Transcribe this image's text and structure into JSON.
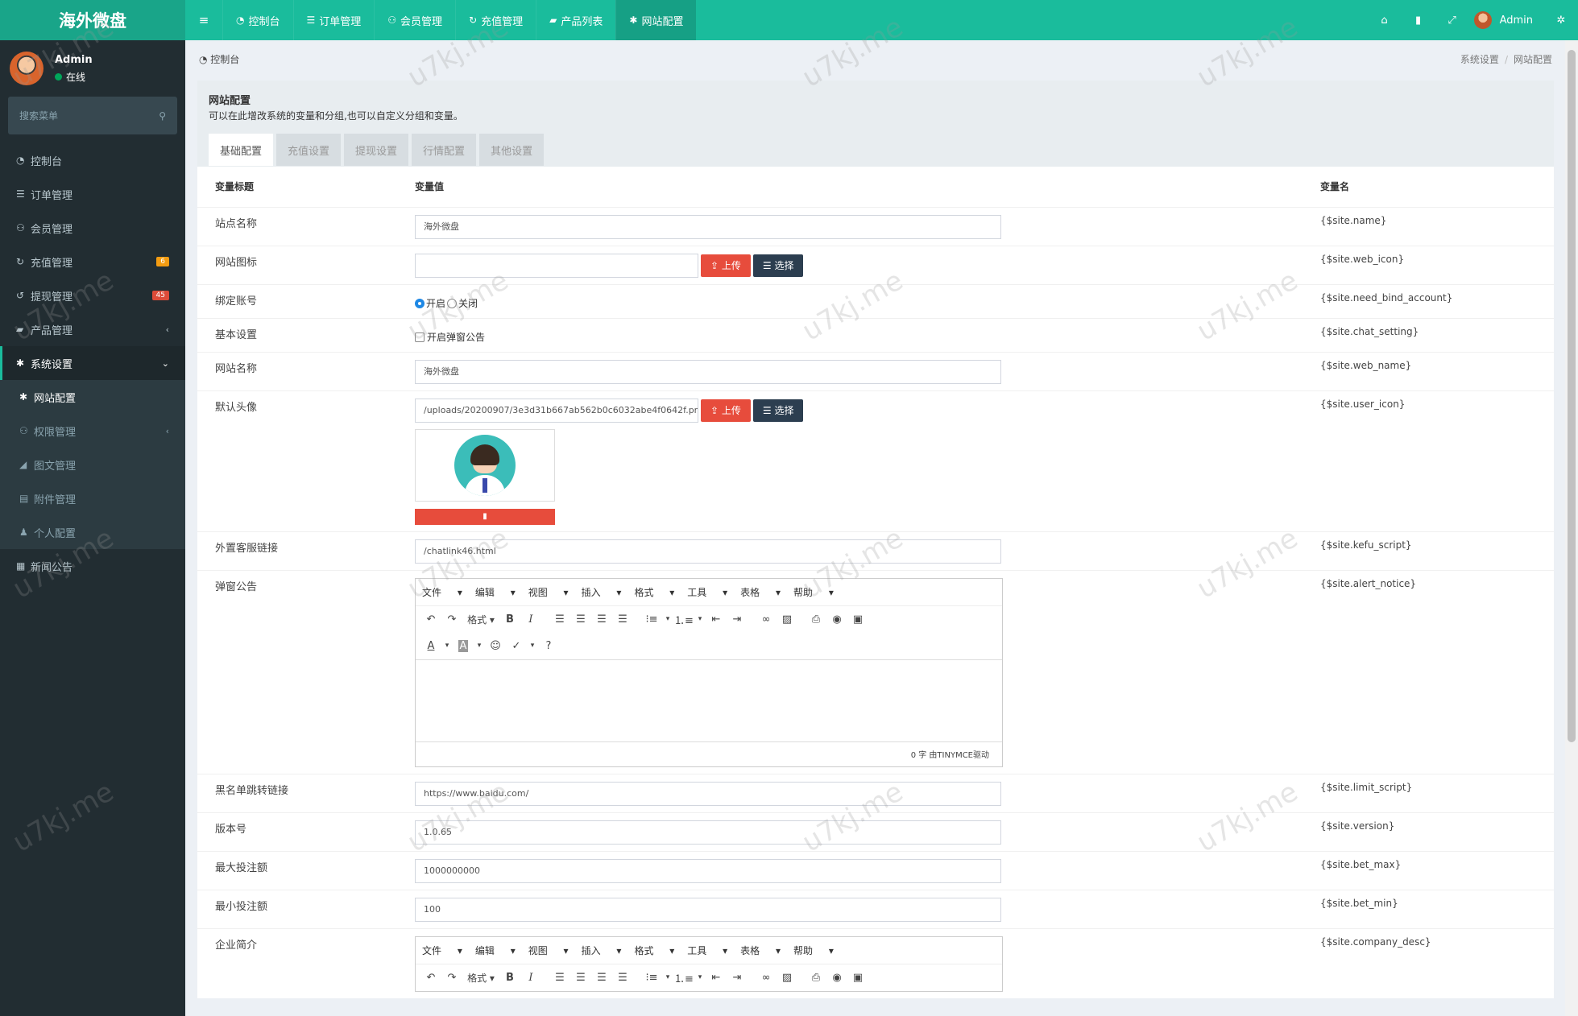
{
  "logo": "海外微盘",
  "topnav": [
    {
      "icon": "dashboard-icon",
      "glyph": "◔",
      "label": "控制台"
    },
    {
      "icon": "list-icon",
      "glyph": "☰",
      "label": "订单管理"
    },
    {
      "icon": "users-icon",
      "glyph": "⚇",
      "label": "会员管理"
    },
    {
      "icon": "recharge-icon",
      "glyph": "↻",
      "label": "充值管理"
    },
    {
      "icon": "product-icon",
      "glyph": "▰",
      "label": "产品列表"
    },
    {
      "icon": "gear-icon",
      "glyph": "✱",
      "label": "网站配置"
    }
  ],
  "topright": {
    "user": "Admin"
  },
  "sidebar": {
    "user_name": "Admin",
    "status": "在线",
    "search_placeholder": "搜索菜单",
    "items": [
      {
        "label": "控制台",
        "glyph": "◔"
      },
      {
        "label": "订单管理",
        "glyph": "☰"
      },
      {
        "label": "会员管理",
        "glyph": "⚇"
      },
      {
        "label": "充值管理",
        "glyph": "↻",
        "badge": "6",
        "badge_color": "#f39c12"
      },
      {
        "label": "提现管理",
        "glyph": "↺",
        "badge": "45",
        "badge_color": "#dd4b39"
      },
      {
        "label": "产品管理",
        "glyph": "▰"
      },
      {
        "label": "系统设置",
        "glyph": "✱"
      }
    ],
    "subitems": [
      {
        "label": "网站配置",
        "glyph": "✱"
      },
      {
        "label": "权限管理",
        "glyph": "⚇"
      },
      {
        "label": "图文管理",
        "glyph": "◢"
      },
      {
        "label": "附件管理",
        "glyph": "▤"
      },
      {
        "label": "个人配置",
        "glyph": "♟"
      }
    ],
    "after": {
      "label": "新闻公告",
      "glyph": "▦"
    }
  },
  "breadcrumb": {
    "home": "控制台",
    "right1": "系统设置",
    "right2": "网站配置"
  },
  "panel": {
    "title": "网站配置",
    "desc": "可以在此增改系统的变量和分组,也可以自定义分组和变量。",
    "tabs": [
      "基础配置",
      "充值设置",
      "提现设置",
      "行情配置",
      "其他设置"
    ]
  },
  "table": {
    "headers": [
      "变量标题",
      "变量值",
      "变量名"
    ],
    "upload": "上传",
    "choose": "选择",
    "rows": {
      "site_name": {
        "title": "站点名称",
        "value": "海外微盘",
        "var": "{$site.name}"
      },
      "web_icon": {
        "title": "网站图标",
        "value": "",
        "var": "{$site.web_icon}"
      },
      "bind": {
        "title": "绑定账号",
        "on": "开启",
        "off": "关闭",
        "var": "{$site.need_bind_account}"
      },
      "basic": {
        "title": "基本设置",
        "check": "开启弹窗公告",
        "var": "{$site.chat_setting}"
      },
      "web_name": {
        "title": "网站名称",
        "value": "海外微盘",
        "var": "{$site.web_name}"
      },
      "user_icon": {
        "title": "默认头像",
        "value": "/uploads/20200907/3e3d31b667ab562b0c6032abe4f0642f.pr",
        "var": "{$site.user_icon}"
      },
      "kefu": {
        "title": "外置客服链接",
        "value": "/chatlink46.html",
        "var": "{$site.kefu_script}"
      },
      "alert": {
        "title": "弹窗公告",
        "var": "{$site.alert_notice}"
      },
      "limit": {
        "title": "黑名单跳转链接",
        "value": "https://www.baidu.com/",
        "var": "{$site.limit_script}"
      },
      "version": {
        "title": "版本号",
        "value": "1.0.65",
        "var": "{$site.version}"
      },
      "bet_max": {
        "title": "最大投注额",
        "value": "1000000000",
        "var": "{$site.bet_max}"
      },
      "bet_min": {
        "title": "最小投注额",
        "value": "100",
        "var": "{$site.bet_min}"
      },
      "company": {
        "title": "企业简介",
        "var": "{$site.company_desc}"
      }
    }
  },
  "editor": {
    "menus": [
      "文件",
      "编辑",
      "视图",
      "插入",
      "格式",
      "工具",
      "表格",
      "帮助"
    ],
    "format": "格式",
    "footer": "0 字 由TINYMCE驱动"
  },
  "watermark": "u7kj.me"
}
